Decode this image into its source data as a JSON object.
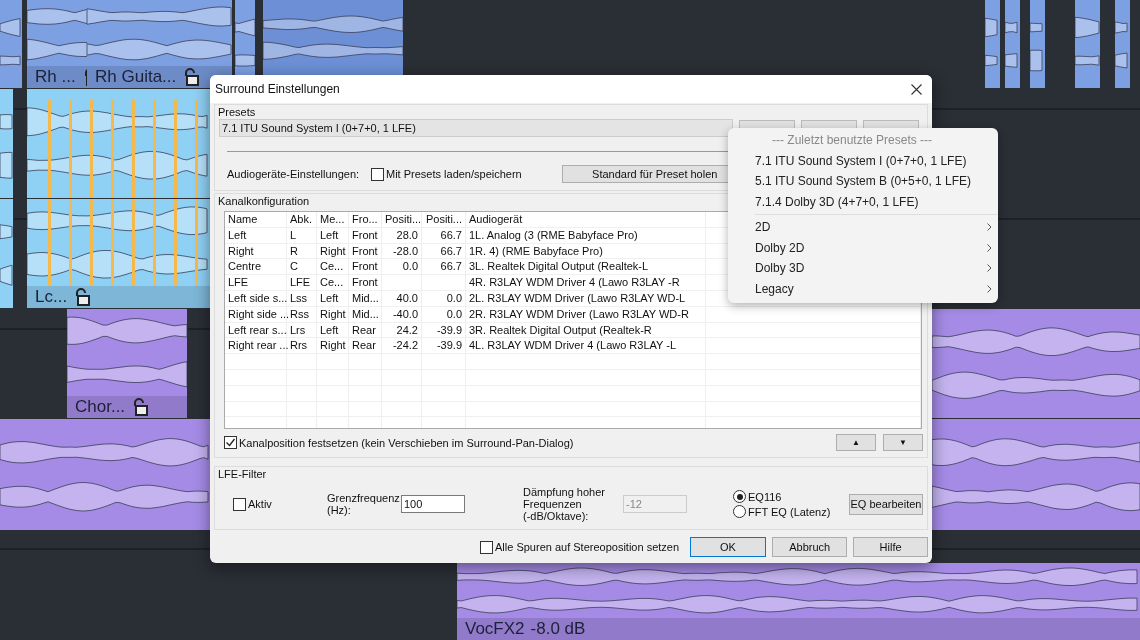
{
  "arrangement": {
    "clips": [
      {
        "label": "Rh ..."
      },
      {
        "label": "Rh Guita..."
      },
      {
        "label": "Lc..."
      },
      {
        "label": "Chor..."
      },
      {
        "label": "VocFX2",
        "volume": "-8.0 dB"
      }
    ]
  },
  "dialog": {
    "title": "Surround Einstellungen",
    "presets": {
      "group": "Presets",
      "value": "7.1 ITU Sound System I (0+7+0, 1 LFE)"
    },
    "audio_settings": {
      "label": "Audiogeräte-Einstellungen:",
      "checkbox": {
        "label": "Mit Presets laden/speichern",
        "checked": false
      },
      "button": "Standard für Preset holen"
    },
    "channel_config": {
      "group": "Kanalkonfiguration",
      "columns": [
        "Name",
        "Abk.",
        "Me...",
        "Fro...",
        "Positi...",
        "Positi...",
        "Audiogerät"
      ],
      "rows": [
        [
          "Left",
          "L",
          "Left",
          "Front",
          "28.0",
          "66.7",
          "1L.  Analog (3 (RME Babyface Pro)"
        ],
        [
          "Right",
          "R",
          "Right",
          "Front",
          "-28.0",
          "66.7",
          "1R.  4)  (RME Babyface Pro)"
        ],
        [
          "Centre",
          "C",
          "Ce...",
          "Front",
          "0.0",
          "66.7",
          "3L.  Realtek Digital Output (Realtek-L"
        ],
        [
          "LFE",
          "LFE",
          "Ce...",
          "Front",
          "",
          "",
          "4R.  R3LAY WDM Driver 4 (Lawo R3LAY -R"
        ],
        [
          "Left side s...",
          "Lss",
          "Left",
          "Mid...",
          "40.0",
          "0.0",
          "2L.  R3LAY WDM Driver (Lawo R3LAY WD-L"
        ],
        [
          "Right side ...",
          "Rss",
          "Right",
          "Mid...",
          "-40.0",
          "0.0",
          "2R.  R3LAY WDM Driver (Lawo R3LAY WD-R"
        ],
        [
          "Left rear s...",
          "Lrs",
          "Left",
          "Rear",
          "24.2",
          "-39.9",
          "3R.  Realtek Digital Output (Realtek-R"
        ],
        [
          "Right rear ...",
          "Rrs",
          "Right",
          "Rear",
          "-24.2",
          "-39.9",
          "4L.  R3LAY WDM Driver 4 (Lawo R3LAY -L"
        ]
      ],
      "lock_checkbox": {
        "label": "Kanalposition festsetzen (kein Verschieben im Surround-Pan-Dialog)",
        "checked": true
      },
      "move_buttons": [
        "▲",
        "▼"
      ]
    },
    "lfe_filter": {
      "group": "LFE-Filter",
      "active": {
        "label": "Aktiv",
        "checked": false
      },
      "cutoff": {
        "label": "Grenzfrequenz\n(Hz):",
        "value": "100"
      },
      "attenuation": {
        "label": "Dämpfung hoher\nFrequenzen\n(-dB/Oktave):",
        "value": "-12",
        "disabled": true
      },
      "eq_options": [
        {
          "label": "EQ116",
          "selected": true
        },
        {
          "label": "FFT EQ (Latenz)",
          "selected": false
        }
      ],
      "edit_button": "EQ bearbeiten"
    },
    "stereo_checkbox": {
      "label": "Alle Spuren auf Stereoposition setzen",
      "checked": false
    },
    "buttons": [
      {
        "label": "OK",
        "default": true
      },
      {
        "label": "Abbruch",
        "default": false
      },
      {
        "label": "Hilfe",
        "default": false
      }
    ]
  },
  "preset_menu": {
    "items": [
      {
        "kind": "header",
        "label": "--- Zuletzt benutzte Presets ---"
      },
      {
        "kind": "item",
        "label": "7.1 ITU Sound System I (0+7+0, 1 LFE)"
      },
      {
        "kind": "item",
        "label": "5.1 ITU Sound System B (0+5+0, 1 LFE)"
      },
      {
        "kind": "item",
        "label": "7.1.4 Dolby 3D (4+7+0, 1 LFE)"
      },
      {
        "kind": "separator"
      },
      {
        "kind": "submenu",
        "label": "2D"
      },
      {
        "kind": "submenu",
        "label": "Dolby 2D"
      },
      {
        "kind": "submenu",
        "label": "Dolby 3D"
      },
      {
        "kind": "submenu",
        "label": "Legacy"
      }
    ]
  }
}
